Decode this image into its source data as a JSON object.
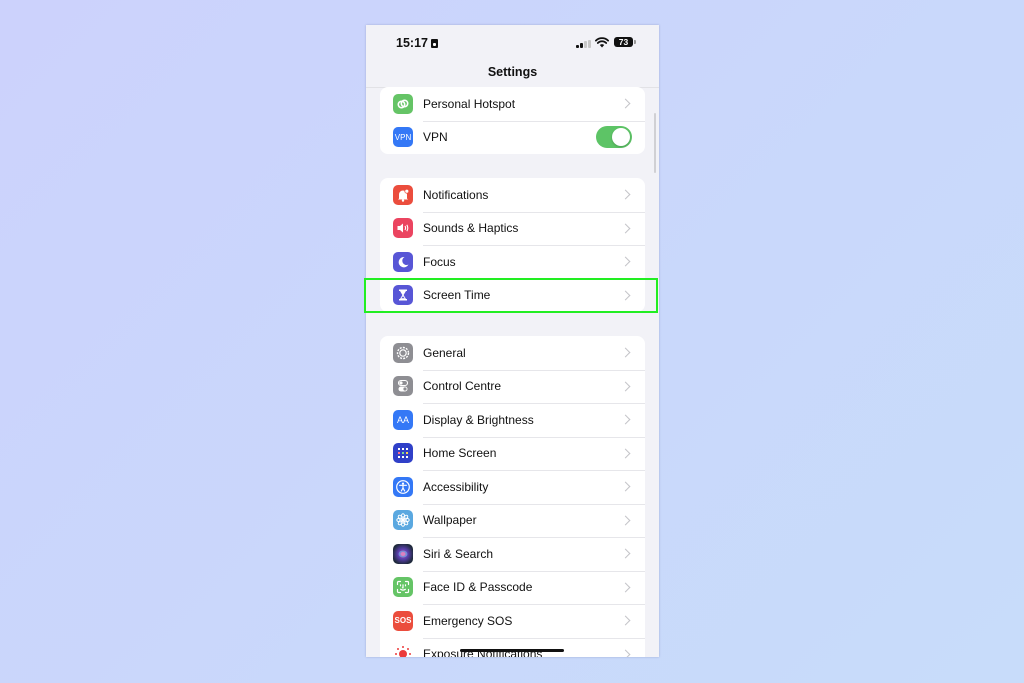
{
  "status_bar": {
    "time": "15:17",
    "battery_level": "73",
    "signal_icon": "cellular-signal-icon",
    "wifi_icon": "wifi-icon"
  },
  "nav": {
    "title": "Settings"
  },
  "groups": [
    {
      "items": [
        {
          "label": "Personal Hotspot",
          "icon": "hotspot-icon",
          "icon_color": "#65C466",
          "accessory": "chevron"
        },
        {
          "label": "VPN",
          "icon": "vpn-icon",
          "icon_color": "#3478F6",
          "icon_text": "VPN",
          "accessory": "toggle",
          "toggle_on": true
        }
      ]
    },
    {
      "items": [
        {
          "label": "Notifications",
          "icon": "notifications-bell-icon",
          "icon_color": "#EB4D3D",
          "accessory": "chevron"
        },
        {
          "label": "Sounds & Haptics",
          "icon": "speaker-icon",
          "icon_color": "#EB4460",
          "accessory": "chevron"
        },
        {
          "label": "Focus",
          "icon": "moon-icon",
          "icon_color": "#5856D6",
          "accessory": "chevron"
        },
        {
          "label": "Screen Time",
          "icon": "hourglass-icon",
          "icon_color": "#5856D6",
          "accessory": "chevron",
          "highlighted": true
        }
      ]
    },
    {
      "items": [
        {
          "label": "General",
          "icon": "gear-icon",
          "icon_color": "#8E8E93",
          "accessory": "chevron"
        },
        {
          "label": "Control Centre",
          "icon": "control-centre-toggles-icon",
          "icon_color": "#8E8E93",
          "accessory": "chevron"
        },
        {
          "label": "Display & Brightness",
          "icon": "text-size-icon",
          "icon_color": "#3478F6",
          "icon_text": "AA",
          "accessory": "chevron"
        },
        {
          "label": "Home Screen",
          "icon": "home-screen-grid-icon",
          "icon_color": "#3040C8",
          "accessory": "chevron"
        },
        {
          "label": "Accessibility",
          "icon": "accessibility-icon",
          "icon_color": "#3478F6",
          "accessory": "chevron"
        },
        {
          "label": "Wallpaper",
          "icon": "wallpaper-flower-icon",
          "icon_color": "#5AA8E0",
          "accessory": "chevron"
        },
        {
          "label": "Siri & Search",
          "icon": "siri-icon",
          "icon_color": "#222233",
          "accessory": "chevron"
        },
        {
          "label": "Face ID & Passcode",
          "icon": "face-id-icon",
          "icon_color": "#65C466",
          "accessory": "chevron"
        },
        {
          "label": "Emergency SOS",
          "icon": "sos-icon",
          "icon_color": "#EB4D3D",
          "icon_text": "SOS",
          "accessory": "chevron"
        },
        {
          "label": "Exposure Notifications",
          "icon": "exposure-icon",
          "icon_color": "#FFFFFF",
          "accessory": "chevron"
        }
      ]
    }
  ],
  "highlight": {
    "target": "Screen Time",
    "color": "#22EE22"
  }
}
